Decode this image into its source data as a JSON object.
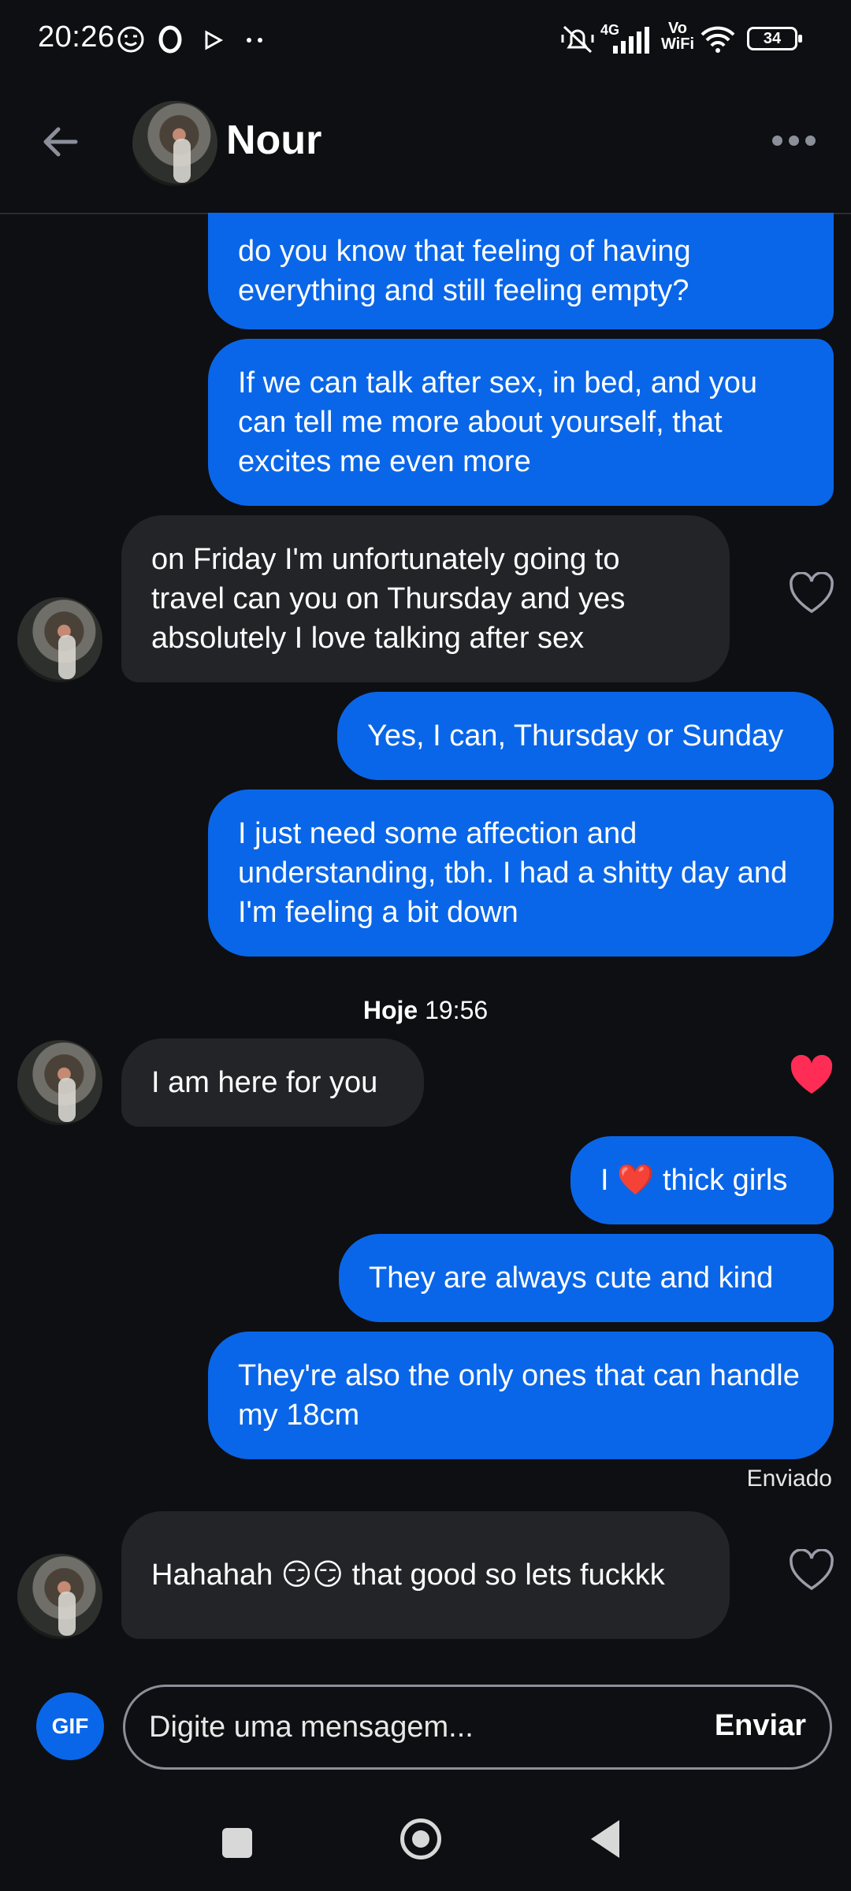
{
  "status_bar": {
    "time": "20:26",
    "network": "4G",
    "volte": "Vo WiFi",
    "battery": "34"
  },
  "header": {
    "contact_name": "Nour"
  },
  "messages": [
    {
      "text": "do you know that feeling of having everything and still feeling empty?"
    },
    {
      "text": "If we can talk after sex, in bed, and you can tell me more about yourself, that excites me even more"
    },
    {
      "text": "on Friday I'm unfortunately going to travel can you on Thursday and yes absolutely I love talking after sex"
    },
    {
      "text": "Yes, I can, Thursday or Sunday"
    },
    {
      "text": "I just need some affection and understanding, tbh. I had a shitty day and I'm feeling a bit down"
    },
    {
      "text": "I am here for you"
    },
    {
      "text": "I ❤️ thick girls"
    },
    {
      "text": "They are always cute and kind"
    },
    {
      "text": "They're also the only ones that can handle my 18cm"
    },
    {
      "text": "Hahahah 😏😏 that good so lets fuckkk"
    }
  ],
  "date_separator": {
    "day": "Hoje",
    "time": "19:56"
  },
  "delivery_status": "Enviado",
  "composer": {
    "gif_label": "GIF",
    "placeholder": "Digite uma mensagem...",
    "send_label": "Enviar"
  },
  "colors": {
    "sent_bubble": "#0a66e8",
    "received_bubble": "#232428",
    "liked_heart": "#ff2d55"
  }
}
